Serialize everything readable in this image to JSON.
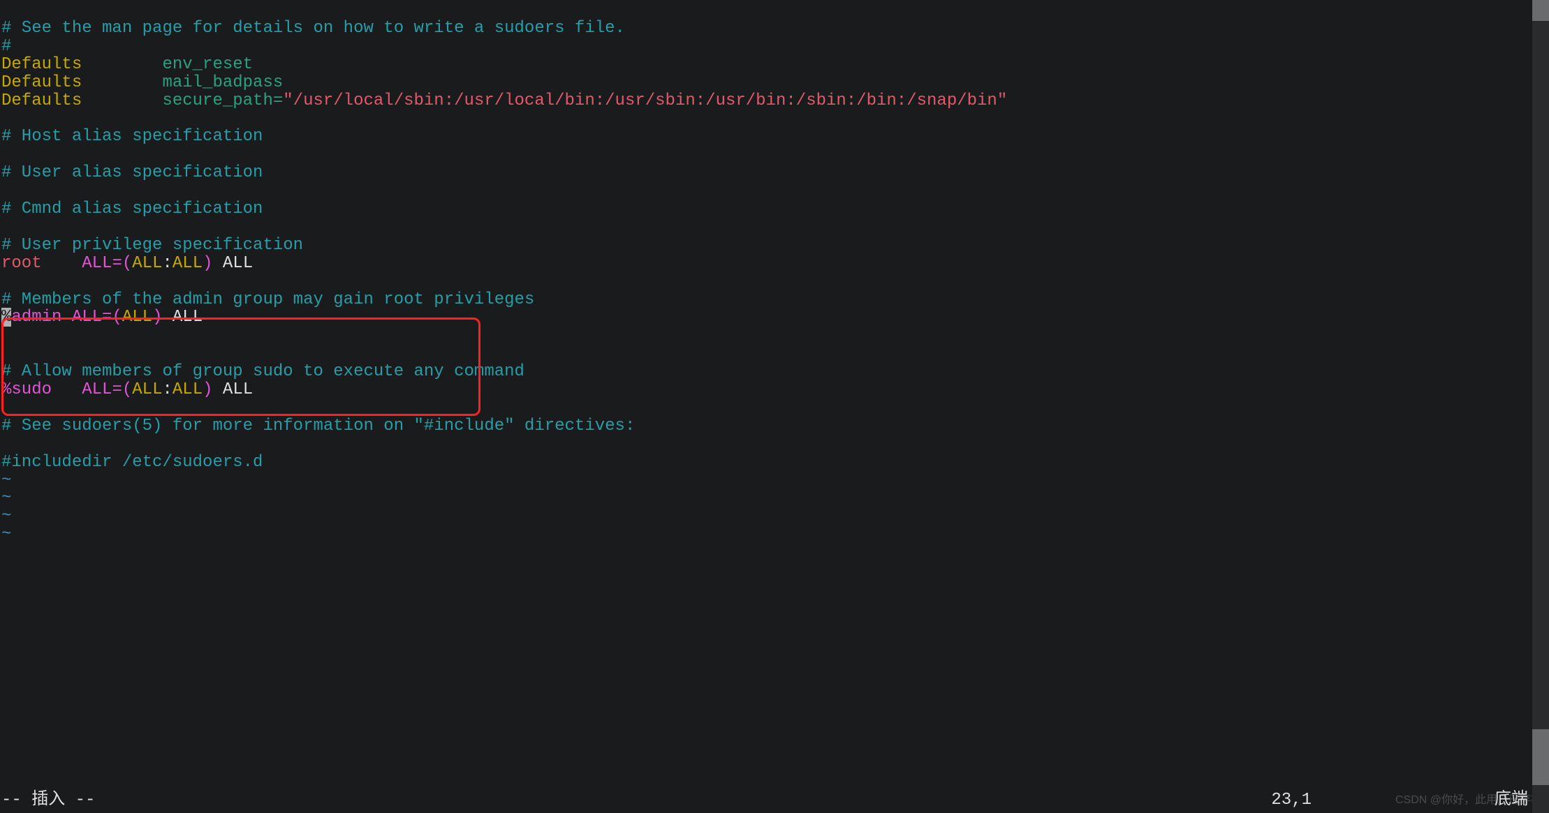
{
  "lines": {
    "c1": "# See the man page for details on how to write a sudoers file.",
    "c2": "#",
    "kw_defaults1": "Defaults",
    "opt_env_reset": "env_reset",
    "kw_defaults2": "Defaults",
    "opt_mail_badpass": "mail_badpass",
    "kw_defaults3": "Defaults",
    "opt_secure_path_eq": "secure_path=",
    "path_value": "\"/usr/local/sbin:/usr/local/bin:/usr/sbin:/usr/bin:/sbin:/bin:/snap/bin\"",
    "c_host": "# Host alias specification",
    "c_user": "# User alias specification",
    "c_cmnd": "# Cmnd alias specification",
    "c_priv": "# User privilege specification",
    "root": "root",
    "all1": "ALL",
    "eq": "=",
    "lp": "(",
    "all_in1": "ALL",
    "colon": ":",
    "all_in2": "ALL",
    "rp": ")",
    "all_cmd": "ALL",
    "c_admin": "# Members of the admin group may gain root privileges",
    "pct": "%",
    "admin": "admin ",
    "admin_all1": "ALL",
    "admin_all_in": "ALL",
    "admin_all_cmd": "ALL",
    "c_sudo": "# Allow members of group sudo to execute any command",
    "sudo_group": "%sudo",
    "sudo_all1": "ALL",
    "sudo_all_in1": "ALL",
    "sudo_all_in2": "ALL",
    "sudo_all_cmd": "ALL",
    "c_include": "# See sudoers(5) for more information on \"#include\" directives:",
    "c_includedir": "#includedir /etc/sudoers.d",
    "tilde": "~"
  },
  "status": {
    "mode": "-- 插入 --",
    "pos": "23,1",
    "right": "底端"
  },
  "watermark": "CSDN @你好，此用户已存在"
}
